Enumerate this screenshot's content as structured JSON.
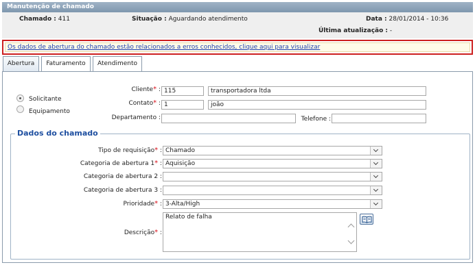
{
  "window": {
    "title": "Manutenção de chamado"
  },
  "info": {
    "chamado_label": "Chamado :",
    "chamado_value": "411",
    "situacao_label": "Situação :",
    "situacao_value": "Aguardando atendimento",
    "data_label": "Data :",
    "data_value": "28/01/2014 - 10:36",
    "ultima_label": "Última atualização :",
    "ultima_value": "-"
  },
  "alert": {
    "text": "Os dados de abertura do chamado estão relacionados a erros conhecidos, clique aqui para visualizar"
  },
  "tabs": [
    {
      "label": "Abertura",
      "active": true
    },
    {
      "label": "Faturamento",
      "active": false
    },
    {
      "label": "Atendimento",
      "active": false
    }
  ],
  "requester": {
    "radio_solicitante": "Solicitante",
    "radio_equipamento": "Equipamento",
    "selected": "Solicitante",
    "cliente_label": "Cliente",
    "cliente_code": "115",
    "cliente_name": "transportadora ltda",
    "contato_label": "Contato",
    "contato_code": "1",
    "contato_name": "joão",
    "departamento_label": "Departamento :",
    "departamento_value": "",
    "telefone_label": "Telefone :",
    "telefone_value": ""
  },
  "dados": {
    "legend": "Dados do chamado",
    "tipo_label": "Tipo de requisição",
    "tipo_value": "Chamado",
    "cat1_label": "Categoria de abertura 1",
    "cat1_value": "Aquisição",
    "cat2_label": "Categoria de abertura 2 :",
    "cat2_value": "",
    "cat3_label": "Categoria de abertura 3 :",
    "cat3_value": "",
    "prioridade_label": "Prioridade",
    "prioridade_value": "3-Alta/High",
    "descricao_label": "Descrição",
    "descricao_value": "Relato de falha"
  },
  "common": {
    "required_mark": "*",
    "colon": " :"
  },
  "colors": {
    "alert_border": "#cc1f1f",
    "link": "#1b3fb0",
    "required": "#d8101a",
    "legend": "#1e4fa0"
  }
}
